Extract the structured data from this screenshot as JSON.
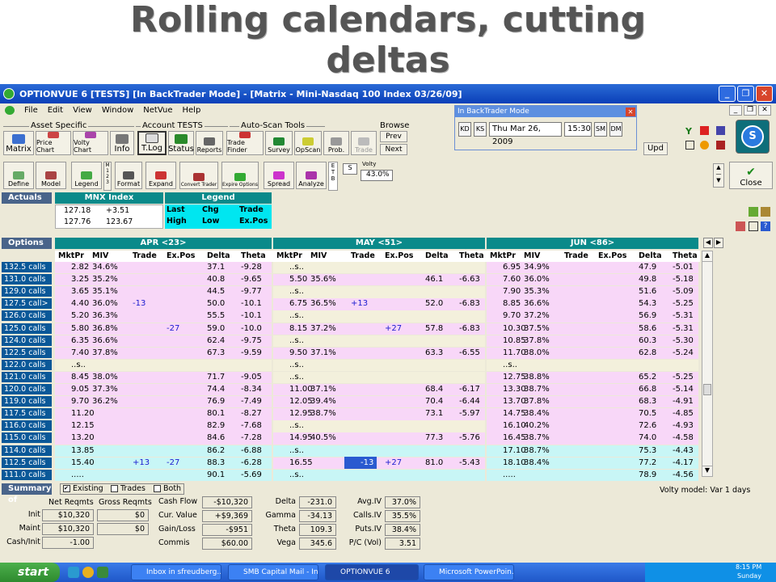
{
  "slide_title": "Rolling calendars, cutting deltas",
  "window": {
    "title": "OPTIONVUE 6   [TESTS]   [In BackTrader Mode]  - [Matrix  - Mini-Nasdaq 100 Index  03/26/09]"
  },
  "menu": [
    "File",
    "Edit",
    "View",
    "Window",
    "NetVue",
    "Help"
  ],
  "toolbar": {
    "groups": {
      "asset": "Asset Specific",
      "account": "Account TESTS",
      "autoscan": "Auto-Scan Tools",
      "browse": "Browse"
    },
    "buttons": [
      "Matrix",
      "Price Chart",
      "Volty Chart",
      "Info",
      "T.Log",
      "Status",
      "Reports",
      "Trade Finder",
      "Survey",
      "OpScan",
      "Prob.",
      "Trade"
    ],
    "prev": "Prev",
    "next": "Next",
    "upd": "Upd"
  },
  "backtrader": {
    "title": "In BackTrader Mode",
    "date": "Thu Mar 26, 2009",
    "time": "15:30",
    "nav": [
      "KD",
      "KS",
      "SM",
      "DM"
    ]
  },
  "toolbar2": {
    "buttons": [
      "Define",
      "Model",
      "Legend",
      "Format",
      "Expand",
      "Convert Trader",
      "Expire Options",
      "Spread",
      "Analyze"
    ],
    "model_digits": [
      "M",
      "1",
      "2",
      "3"
    ],
    "etb": [
      "E",
      "T",
      "B"
    ],
    "s_label": "S",
    "volty_label": "Volty",
    "volty_value": "43.0%",
    "close": "Close"
  },
  "actuals": {
    "label": "Actuals",
    "index_header": "MNX Index",
    "legend_header": "Legend",
    "rows": [
      [
        "127.18",
        "+3.51"
      ],
      [
        "127.76",
        "123.67"
      ]
    ],
    "legend": [
      [
        "Last",
        "Chg",
        "Trade"
      ],
      [
        "High",
        "Low",
        "Ex.Pos"
      ]
    ]
  },
  "options": {
    "label": "Options",
    "months": [
      "APR <23>",
      "MAY <51>",
      "JUN <86>"
    ],
    "columns": [
      "MktPr",
      "MIV",
      "Trade",
      "Ex.Pos",
      "Delta",
      "Theta"
    ],
    "rows": [
      {
        "strike": "132.5 calls",
        "a": [
          "2.82",
          "34.6%",
          "",
          "",
          "37.1",
          "-9.28"
        ],
        "m": [
          "..s..",
          "",
          "",
          "",
          "",
          ""
        ],
        "j": [
          "6.95",
          "34.9%",
          "",
          "",
          "47.9",
          "-5.01"
        ]
      },
      {
        "strike": "131.0 calls",
        "a": [
          "3.25",
          "35.2%",
          "",
          "",
          "40.8",
          "-9.65"
        ],
        "m": [
          "5.50",
          "35.6%",
          "",
          "",
          "46.1",
          "-6.63"
        ],
        "j": [
          "7.60",
          "36.0%",
          "",
          "",
          "49.8",
          "-5.18"
        ]
      },
      {
        "strike": "129.0 calls",
        "a": [
          "3.65",
          "35.1%",
          "",
          "",
          "44.5",
          "-9.77"
        ],
        "m": [
          "..s..",
          "",
          "",
          "",
          "",
          ""
        ],
        "j": [
          "7.90",
          "35.3%",
          "",
          "",
          "51.6",
          "-5.09"
        ]
      },
      {
        "strike": "127.5 call>",
        "a": [
          "4.40",
          "36.0%",
          "-13",
          "",
          "50.0",
          "-10.1"
        ],
        "m": [
          "6.75",
          "36.5%",
          "+13",
          "",
          "52.0",
          "-6.83"
        ],
        "j": [
          "8.85",
          "36.6%",
          "",
          "",
          "54.3",
          "-5.25"
        ]
      },
      {
        "strike": "126.0 calls",
        "a": [
          "5.20",
          "36.3%",
          "",
          "",
          "55.5",
          "-10.1"
        ],
        "m": [
          "..s..",
          "",
          "",
          "",
          "",
          ""
        ],
        "j": [
          "9.70",
          "37.2%",
          "",
          "",
          "56.9",
          "-5.31"
        ]
      },
      {
        "strike": "125.0 calls",
        "a": [
          "5.80",
          "36.8%",
          "",
          "-27",
          "59.0",
          "-10.0"
        ],
        "m": [
          "8.15",
          "37.2%",
          "",
          "+27",
          "57.8",
          "-6.83"
        ],
        "j": [
          "10.30",
          "37.5%",
          "",
          "",
          "58.6",
          "-5.31"
        ]
      },
      {
        "strike": "124.0 calls",
        "a": [
          "6.35",
          "36.6%",
          "",
          "",
          "62.4",
          "-9.75"
        ],
        "m": [
          "..s..",
          "",
          "",
          "",
          "",
          ""
        ],
        "j": [
          "10.85",
          "37.8%",
          "",
          "",
          "60.3",
          "-5.30"
        ]
      },
      {
        "strike": "122.5 calls",
        "a": [
          "7.40",
          "37.8%",
          "",
          "",
          "67.3",
          "-9.59"
        ],
        "m": [
          "9.50",
          "37.1%",
          "",
          "",
          "63.3",
          "-6.55"
        ],
        "j": [
          "11.70",
          "38.0%",
          "",
          "",
          "62.8",
          "-5.24"
        ]
      },
      {
        "strike": "122.0 calls",
        "a": [
          "..s..",
          "",
          "",
          "",
          "",
          ""
        ],
        "m": [
          "..s..",
          "",
          "",
          "",
          "",
          ""
        ],
        "j": [
          "..s..",
          "",
          "",
          "",
          "",
          ""
        ]
      },
      {
        "strike": "121.0 calls",
        "a": [
          "8.45",
          "38.0%",
          "",
          "",
          "71.7",
          "-9.05"
        ],
        "m": [
          "..s..",
          "",
          "",
          "",
          "",
          ""
        ],
        "j": [
          "12.75",
          "38.8%",
          "",
          "",
          "65.2",
          "-5.25"
        ]
      },
      {
        "strike": "120.0 calls",
        "a": [
          "9.05",
          "37.3%",
          "",
          "",
          "74.4",
          "-8.34"
        ],
        "m": [
          "11.00",
          "37.1%",
          "",
          "",
          "68.4",
          "-6.17"
        ],
        "j": [
          "13.30",
          "38.7%",
          "",
          "",
          "66.8",
          "-5.14"
        ]
      },
      {
        "strike": "119.0 calls",
        "a": [
          "9.70",
          "36.2%",
          "",
          "",
          "76.9",
          "-7.49"
        ],
        "m": [
          "12.05",
          "39.4%",
          "",
          "",
          "70.4",
          "-6.44"
        ],
        "j": [
          "13.70",
          "37.8%",
          "",
          "",
          "68.3",
          "-4.91"
        ]
      },
      {
        "strike": "117.5 calls",
        "a": [
          "11.20",
          "",
          "",
          "",
          "80.1",
          "-8.27"
        ],
        "m": [
          "12.95",
          "38.7%",
          "",
          "",
          "73.1",
          "-5.97"
        ],
        "j": [
          "14.75",
          "38.4%",
          "",
          "",
          "70.5",
          "-4.85"
        ]
      },
      {
        "strike": "116.0 calls",
        "a": [
          "12.15",
          "",
          "",
          "",
          "82.9",
          "-7.68"
        ],
        "m": [
          "..s..",
          "",
          "",
          "",
          "",
          ""
        ],
        "j": [
          "16.10",
          "40.2%",
          "",
          "",
          "72.6",
          "-4.93"
        ]
      },
      {
        "strike": "115.0 calls",
        "a": [
          "13.20",
          "",
          "",
          "",
          "84.6",
          "-7.28"
        ],
        "m": [
          "14.95",
          "40.5%",
          "",
          "",
          "77.3",
          "-5.76"
        ],
        "j": [
          "16.45",
          "38.7%",
          "",
          "",
          "74.0",
          "-4.58"
        ]
      },
      {
        "strike": "114.0 calls",
        "a": [
          "13.85",
          "",
          "",
          "",
          "86.2",
          "-6.88"
        ],
        "m": [
          "..s..",
          "",
          "",
          "",
          "",
          ""
        ],
        "j": [
          "17.10",
          "38.7%",
          "",
          "",
          "75.3",
          "-4.43"
        ]
      },
      {
        "strike": "112.5 calls",
        "a": [
          "15.40",
          "",
          "+13",
          "-27",
          "88.3",
          "-6.28"
        ],
        "m": [
          "16.55",
          "",
          "-13",
          "+27",
          "81.0",
          "-5.43"
        ],
        "j": [
          "18.10",
          "38.4%",
          "",
          "",
          "77.2",
          "-4.17"
        ]
      },
      {
        "strike": "111.0 calls",
        "a": [
          ".....",
          "",
          "",
          "",
          "90.1",
          "-5.69"
        ],
        "m": [
          "..s..",
          "",
          "",
          "",
          "",
          ""
        ],
        "j": [
          ".....",
          "",
          "",
          "",
          "78.9",
          "-4.56"
        ]
      }
    ]
  },
  "summary": {
    "label": "Summary of",
    "existing": "Existing",
    "trades": "Trades",
    "both": "Both",
    "volty_model": "Volty model: Var 1 days",
    "hdr_net": "Net Reqmts",
    "hdr_gross": "Gross Reqmts",
    "reqs": [
      [
        "Init",
        "$10,320",
        "$0"
      ],
      [
        "Maint",
        "$10,320",
        "$0"
      ],
      [
        "Cash/Init",
        "-1.00",
        ""
      ]
    ],
    "cash": [
      [
        "Cash Flow",
        "-$10,320"
      ],
      [
        "Cur. Value",
        "+$9,369"
      ],
      [
        "Gain/Loss",
        "-$951"
      ],
      [
        "Commis",
        "$60.00"
      ]
    ],
    "greeks": [
      [
        "Delta",
        "-231.0"
      ],
      [
        "Gamma",
        "-34.13"
      ],
      [
        "Theta",
        "109.3"
      ],
      [
        "Vega",
        "345.6"
      ]
    ],
    "ivs": [
      [
        "Avg.IV",
        "37.0%"
      ],
      [
        "Calls.IV",
        "35.5%"
      ],
      [
        "Puts.IV",
        "38.4%"
      ],
      [
        "P/C (Vol)",
        "3.51"
      ]
    ]
  },
  "taskbar": {
    "start": "start",
    "tasks": [
      "Inbox in sfreudberg...",
      "SMB Capital Mail - In...",
      "OPTIONVUE 6",
      "Microsoft PowerPoin..."
    ],
    "time": "8:15 PM",
    "day": "Sunday"
  }
}
